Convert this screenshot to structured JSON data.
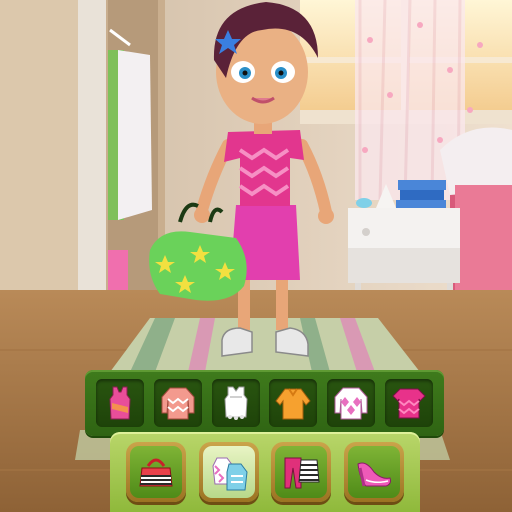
{
  "outfits": {
    "items": [
      {
        "icon": "tank-top-icon",
        "color": "#e84e9a",
        "accent": "#f6a23b"
      },
      {
        "icon": "chevron-sweater-icon",
        "color": "#f39a8e",
        "accent": "#ffffff"
      },
      {
        "icon": "lace-top-icon",
        "color": "#ffffff",
        "accent": "#e4e4e4"
      },
      {
        "icon": "orange-blouse-icon",
        "color": "#f6a12f",
        "accent": "#d57a12"
      },
      {
        "icon": "diamond-sweater-icon",
        "color": "#ffffff",
        "accent": "#e86fc0"
      },
      {
        "icon": "pink-chevron-top-icon",
        "color": "#e8328a",
        "accent": "#ff88c0"
      }
    ]
  },
  "categories": {
    "items": [
      {
        "icon": "handbag-icon",
        "selected": false
      },
      {
        "icon": "tops-icon",
        "selected": true
      },
      {
        "icon": "bottoms-icon",
        "selected": false
      },
      {
        "icon": "shoes-icon",
        "selected": false
      }
    ]
  },
  "colors": {
    "tray_dark": "#2f6413",
    "tray_light": "#8fb93b",
    "skirt": "#e23fae",
    "shirt": "#e2368e",
    "bag": "#6ad25a"
  }
}
